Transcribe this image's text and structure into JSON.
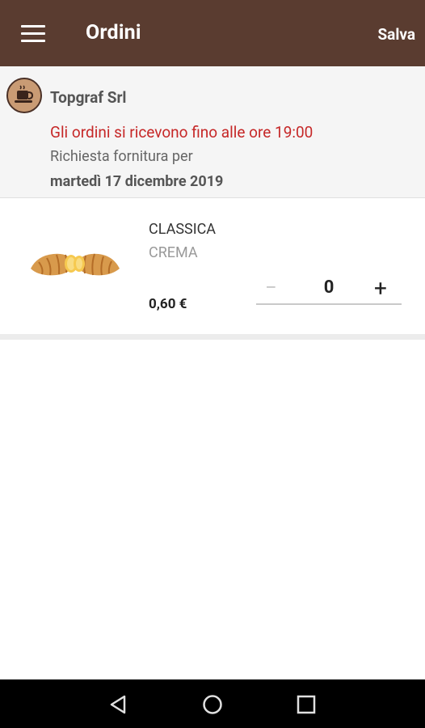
{
  "appbar": {
    "title": "Ordini",
    "save_label": "Salva",
    "menu_icon": "menu-icon",
    "background_color": "#5a3c30"
  },
  "header": {
    "company_name": "Topgraf Srl",
    "avatar_icon": "coffee-cup-icon",
    "notice": "Gli ordini si ricevono fino alle ore 19:00",
    "notice_color": "#c62828",
    "request_label": "Richiesta fornitura per",
    "request_date": "martedì 17 dicembre 2019"
  },
  "products": [
    {
      "name": "CLASSICA",
      "variant": "CREMA",
      "price": "0,60 €",
      "quantity": "0",
      "minus_label": "−",
      "plus_label": "+",
      "image": "croissant-image"
    }
  ],
  "navbar": {
    "icons": [
      "back-icon",
      "home-icon",
      "recents-icon"
    ]
  }
}
